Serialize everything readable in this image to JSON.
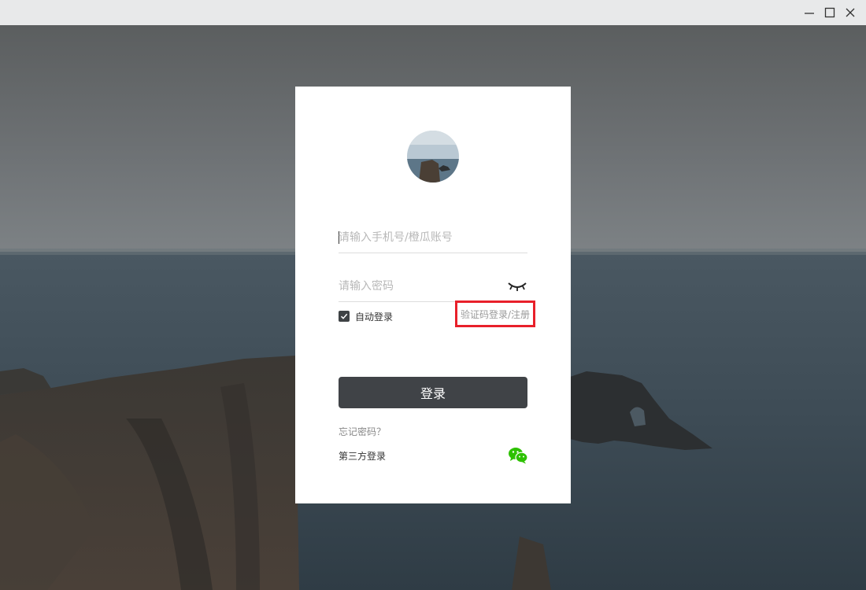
{
  "window": {
    "minimize_icon": "minimize-icon",
    "maximize_icon": "maximize-icon",
    "close_icon": "close-icon"
  },
  "login": {
    "account_placeholder": "请输入手机号/橙瓜账号",
    "account_value": "",
    "password_placeholder": "请输入密码",
    "password_value": "",
    "password_toggle_icon": "eye-closed-icon",
    "auto_login_label": "自动登录",
    "auto_login_checked": true,
    "sms_login_link": "验证码登录/注册",
    "submit_label": "登录",
    "forgot_password": "忘记密码？",
    "third_party_label": "第三方登录",
    "third_party_icon": "wechat-icon"
  },
  "colors": {
    "button_bg": "#404347",
    "highlight_border": "#e8202a",
    "wechat_green": "#2dc100",
    "card_bg": "#ffffff"
  }
}
